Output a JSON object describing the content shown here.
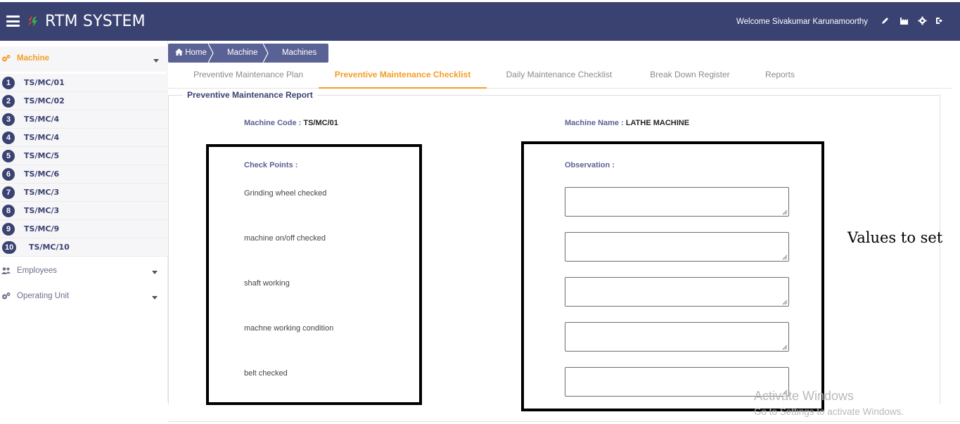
{
  "header": {
    "app_title": "RTM SYSTEM",
    "welcome": "Welcome Sivakumar Karunamoorthy",
    "icons": [
      "pencil-icon",
      "factory-icon",
      "gear-icon",
      "logout-icon"
    ],
    "brand_color": "#3a4271",
    "accent_color": "#f59d24"
  },
  "sidebar": {
    "machine_label": "Machine",
    "items": [
      {
        "num": "1",
        "code": "TS/MC/01"
      },
      {
        "num": "2",
        "code": "TS/MC/02"
      },
      {
        "num": "3",
        "code": "TS/MC/4"
      },
      {
        "num": "4",
        "code": "TS/MC/4"
      },
      {
        "num": "5",
        "code": "TS/MC/5"
      },
      {
        "num": "6",
        "code": "TS/MC/6"
      },
      {
        "num": "7",
        "code": "TS/MC/3"
      },
      {
        "num": "8",
        "code": "TS/MC/3"
      },
      {
        "num": "9",
        "code": "TS/MC/9"
      },
      {
        "num": "10",
        "code": "TS/MC/10"
      }
    ],
    "employees_label": "Employees",
    "operating_unit_label": "Operating Unit"
  },
  "breadcrumb": [
    "Home",
    "Machine",
    "Machines"
  ],
  "tabs": [
    "Preventive Maintenance Plan",
    "Preventive Maintenance Checklist",
    "Daily Maintenance Checklist",
    "Break Down Register",
    "Reports"
  ],
  "active_tab": "Preventive Maintenance Checklist",
  "report": {
    "legend": "Preventive Maintenance Report",
    "machine_code_label": "Machine Code :",
    "machine_code_value": "TS/MC/01",
    "machine_name_label": "Machine Name :",
    "machine_name_value": "LATHE MACHINE",
    "check_points_label": "Check Points :",
    "observation_label": "Observation :",
    "check_points": [
      "Grinding wheel checked",
      "machine on/off checked",
      "shaft working",
      "machne working condition",
      "belt checked"
    ],
    "observations": [
      "",
      "",
      "",
      "",
      ""
    ]
  },
  "annotation": "Values to set",
  "watermark": {
    "line1": "Activate Windows",
    "line2": "Go to Settings to activate Windows."
  }
}
